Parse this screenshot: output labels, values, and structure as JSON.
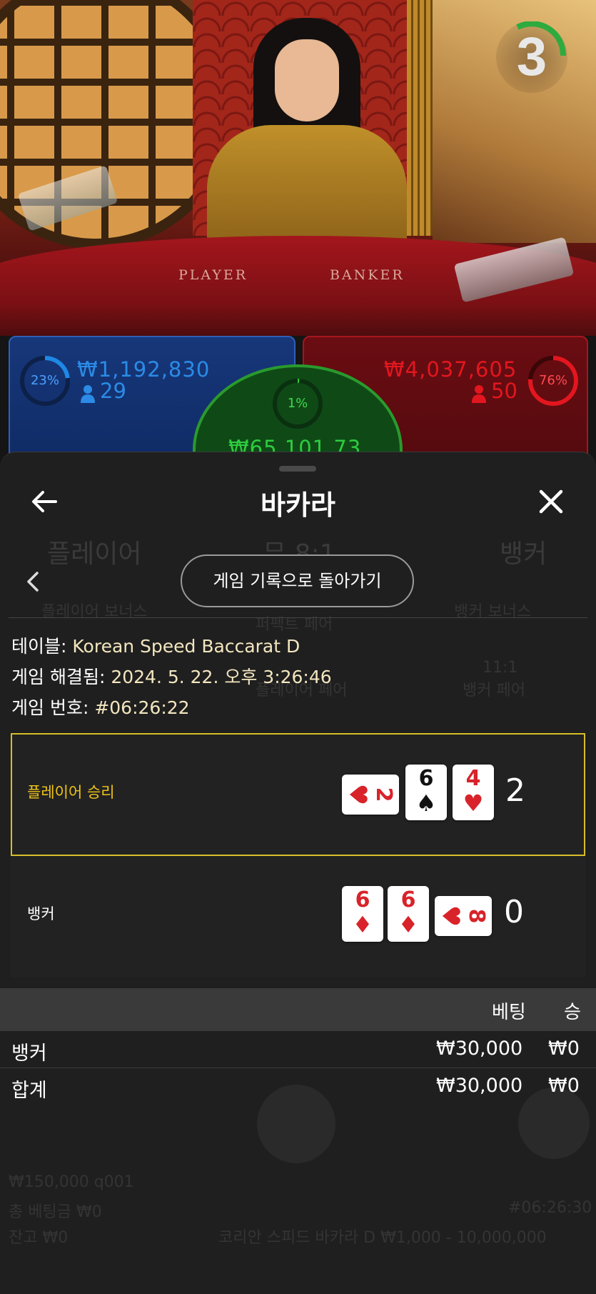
{
  "live": {
    "countdown": "3",
    "table_text_player": "PLAYER",
    "table_text_banker": "BANKER"
  },
  "bets": {
    "player": {
      "percent": "23%",
      "percent_value": 0.23,
      "amount": "₩1,192,830",
      "players": "29",
      "color": "#1e88e5"
    },
    "tie": {
      "percent": "1%",
      "percent_value": 0.01,
      "amount": "₩65,101.73",
      "color": "#2ecc40"
    },
    "banker": {
      "percent": "76%",
      "percent_value": 0.76,
      "amount": "₩4,037,605",
      "players": "50",
      "color": "#e3161f"
    }
  },
  "background_ghost": {
    "player_label": "플레이어",
    "tie_label": "무 8:1",
    "banker_label": "뱅커",
    "player_bonus": "플레이어 보너스",
    "perfect_pair": "퍼펙트 페어",
    "banker_bonus": "뱅커 보너스",
    "player_pair": "플레이어 페어",
    "banker_pair_odds": "11:1",
    "banker_pair": "뱅커 페어",
    "balance_line": "₩150,000 q001",
    "total_bet": "총 베팅금 ₩0",
    "balance": "잔고 ₩0",
    "table_limits": "코리안 스피드 바카라 D ₩1,000 - 10,000,000",
    "round_id": "#06:26:30"
  },
  "sheet": {
    "title": "바카라",
    "back_to_history": "게임 기록으로 돌아가기",
    "table_label": "테이블:",
    "table_value": "Korean Speed Baccarat D",
    "resolved_label": "게임 해결됨:",
    "resolved_value": "2024. 5. 22. 오후 3:26:46",
    "game_no_label": "게임 번호:",
    "game_no_value": "#06:26:22"
  },
  "result": {
    "player": {
      "label": "플레이어 승리",
      "label_color": "#f0c419",
      "score": "2",
      "cards": [
        {
          "rank": "2",
          "suit": "♥",
          "orientation": "sideways"
        },
        {
          "rank": "6",
          "suit": "♠",
          "orientation": "upright"
        },
        {
          "rank": "4",
          "suit": "♥",
          "orientation": "upright"
        }
      ]
    },
    "banker": {
      "label": "뱅커",
      "score": "0",
      "cards": [
        {
          "rank": "6",
          "suit": "♦",
          "orientation": "upright"
        },
        {
          "rank": "6",
          "suit": "♦",
          "orientation": "upright"
        },
        {
          "rank": "8",
          "suit": "♥",
          "orientation": "sideways"
        }
      ]
    }
  },
  "bets_table": {
    "headers": {
      "bet": "베팅",
      "win": "승"
    },
    "rows": [
      {
        "label": "뱅커",
        "bet": "₩30,000",
        "win": "₩0"
      }
    ],
    "total": {
      "label": "합계",
      "bet": "₩30,000",
      "win": "₩0"
    }
  },
  "colors": {
    "accent_yellow": "#d8be2a",
    "sheet_bg": "#1f1f1f"
  }
}
